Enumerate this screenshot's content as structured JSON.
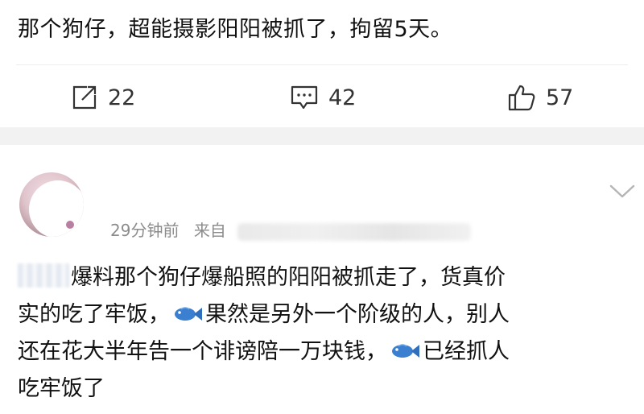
{
  "post": {
    "text": "那个狗仔，超能摄影阳阳被抓了，拘留5天。"
  },
  "actions": {
    "repost_count": "22",
    "comment_count": "42",
    "like_count": "57"
  },
  "comment": {
    "time": "29分钟前",
    "source_prefix": "来自",
    "lines": [
      "爆料那个狗仔爆船照的阳阳被抓走了，货真价",
      "实的吃了牢饭，",
      "果然是另外一个阶级的人，别人",
      "还在花大半年告一个诽谤陪一万块钱，",
      "已经抓人",
      "吃牢饭了"
    ]
  },
  "icons": {
    "repost": "repost-icon",
    "comment": "comment-icon",
    "like": "thumbs-up-icon",
    "more": "chevron-down-icon",
    "emoji": "fish-emoji-icon"
  }
}
